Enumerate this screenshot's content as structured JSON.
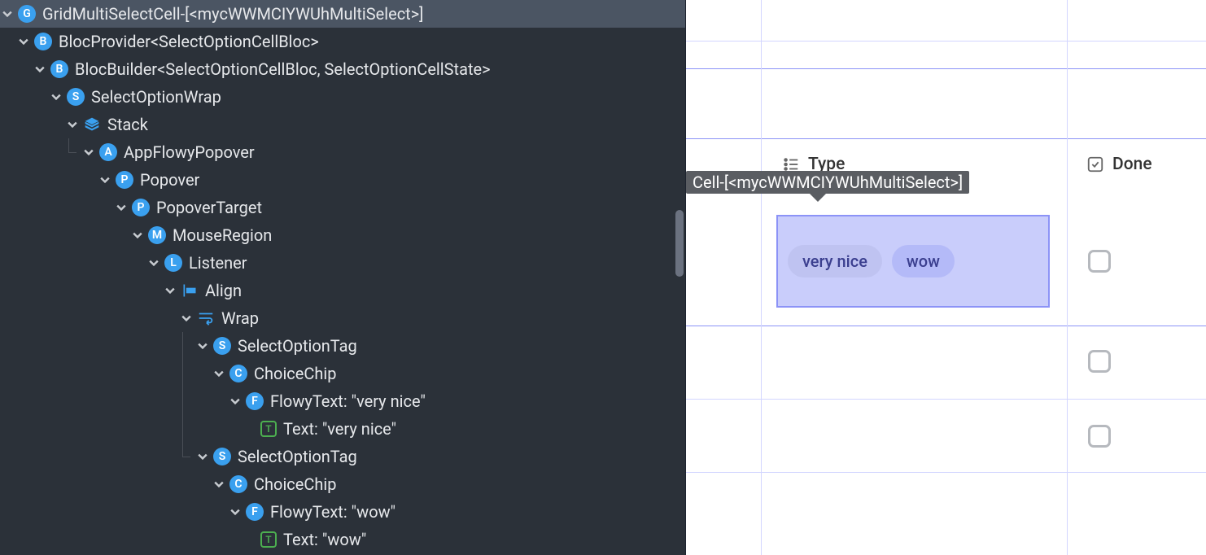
{
  "tree": {
    "n0": "GridMultiSelectCell-[<mycWWMCIYWUhMultiSelect>]",
    "n1": "BlocProvider<SelectOptionCellBloc>",
    "n2": "BlocBuilder<SelectOptionCellBloc, SelectOptionCellState>",
    "n3": "SelectOptionWrap",
    "n4": "Stack",
    "n5": "AppFlowyPopover",
    "n6": "Popover",
    "n7": "PopoverTarget",
    "n8": "MouseRegion",
    "n9": "Listener",
    "n10": "Align",
    "n11": "Wrap",
    "n12": "SelectOptionTag",
    "n13": "ChoiceChip",
    "n14": "FlowyText: \"very nice\"",
    "n15": "Text: \"very nice\"",
    "n16": "SelectOptionTag",
    "n17": "ChoiceChip",
    "n18": "FlowyText: \"wow\"",
    "n19": "Text: \"wow\""
  },
  "badges": {
    "G": "G",
    "B": "B",
    "S": "S",
    "A": "A",
    "P": "P",
    "M": "M",
    "L": "L",
    "C": "C",
    "F": "F",
    "T": "T"
  },
  "preview": {
    "tooltip": "Cell-[<mycWWMCIYWUhMultiSelect>]",
    "col_type": "Type",
    "col_done": "Done",
    "tag1": "very nice",
    "tag2": "wow"
  }
}
